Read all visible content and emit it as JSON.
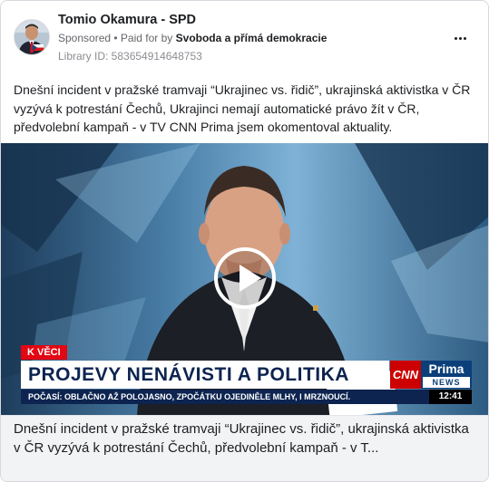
{
  "ad": {
    "page_name": "Tomio Okamura - SPD",
    "sponsored": "Sponsored",
    "paid_prefix": "• Paid for by",
    "paid_by": "Svoboda a přímá demokracie",
    "library_id": "Library ID: 583654914648753",
    "more_icon": "more-dots-icon",
    "body_text": "Dnešní incident v pražské tramvaji “Ukrajinec vs. řidič”, ukrajinská aktivistka v ČR vyzývá k potrestání Čechů, Ukrajinci nemají automatické právo žít v ČR, předvolební kampaň - v TV CNN Prima jsem okomentoval aktuality.",
    "footer_text": "Dnešní incident v pražské tramvaji “Ukrajinec vs. řidič”, ukrajinská aktivistka v ČR vyzývá k potrestání Čechů, předvolební kampaň - v T..."
  },
  "video": {
    "play_icon": "play-icon",
    "tag": "K VĚCI",
    "headline": "PROJEVY NENÁVISTI A POLITIKA",
    "ticker": "POČASÍ: OBLAČNO AŽ POLOJASNO, ZPOČÁTKU OJEDINĚLE MLHY, I MRZNOUCÍ.",
    "channel_cnn": "CNN",
    "channel_prima": "Prima",
    "channel_news": "NEWS",
    "clock": "12:41"
  }
}
